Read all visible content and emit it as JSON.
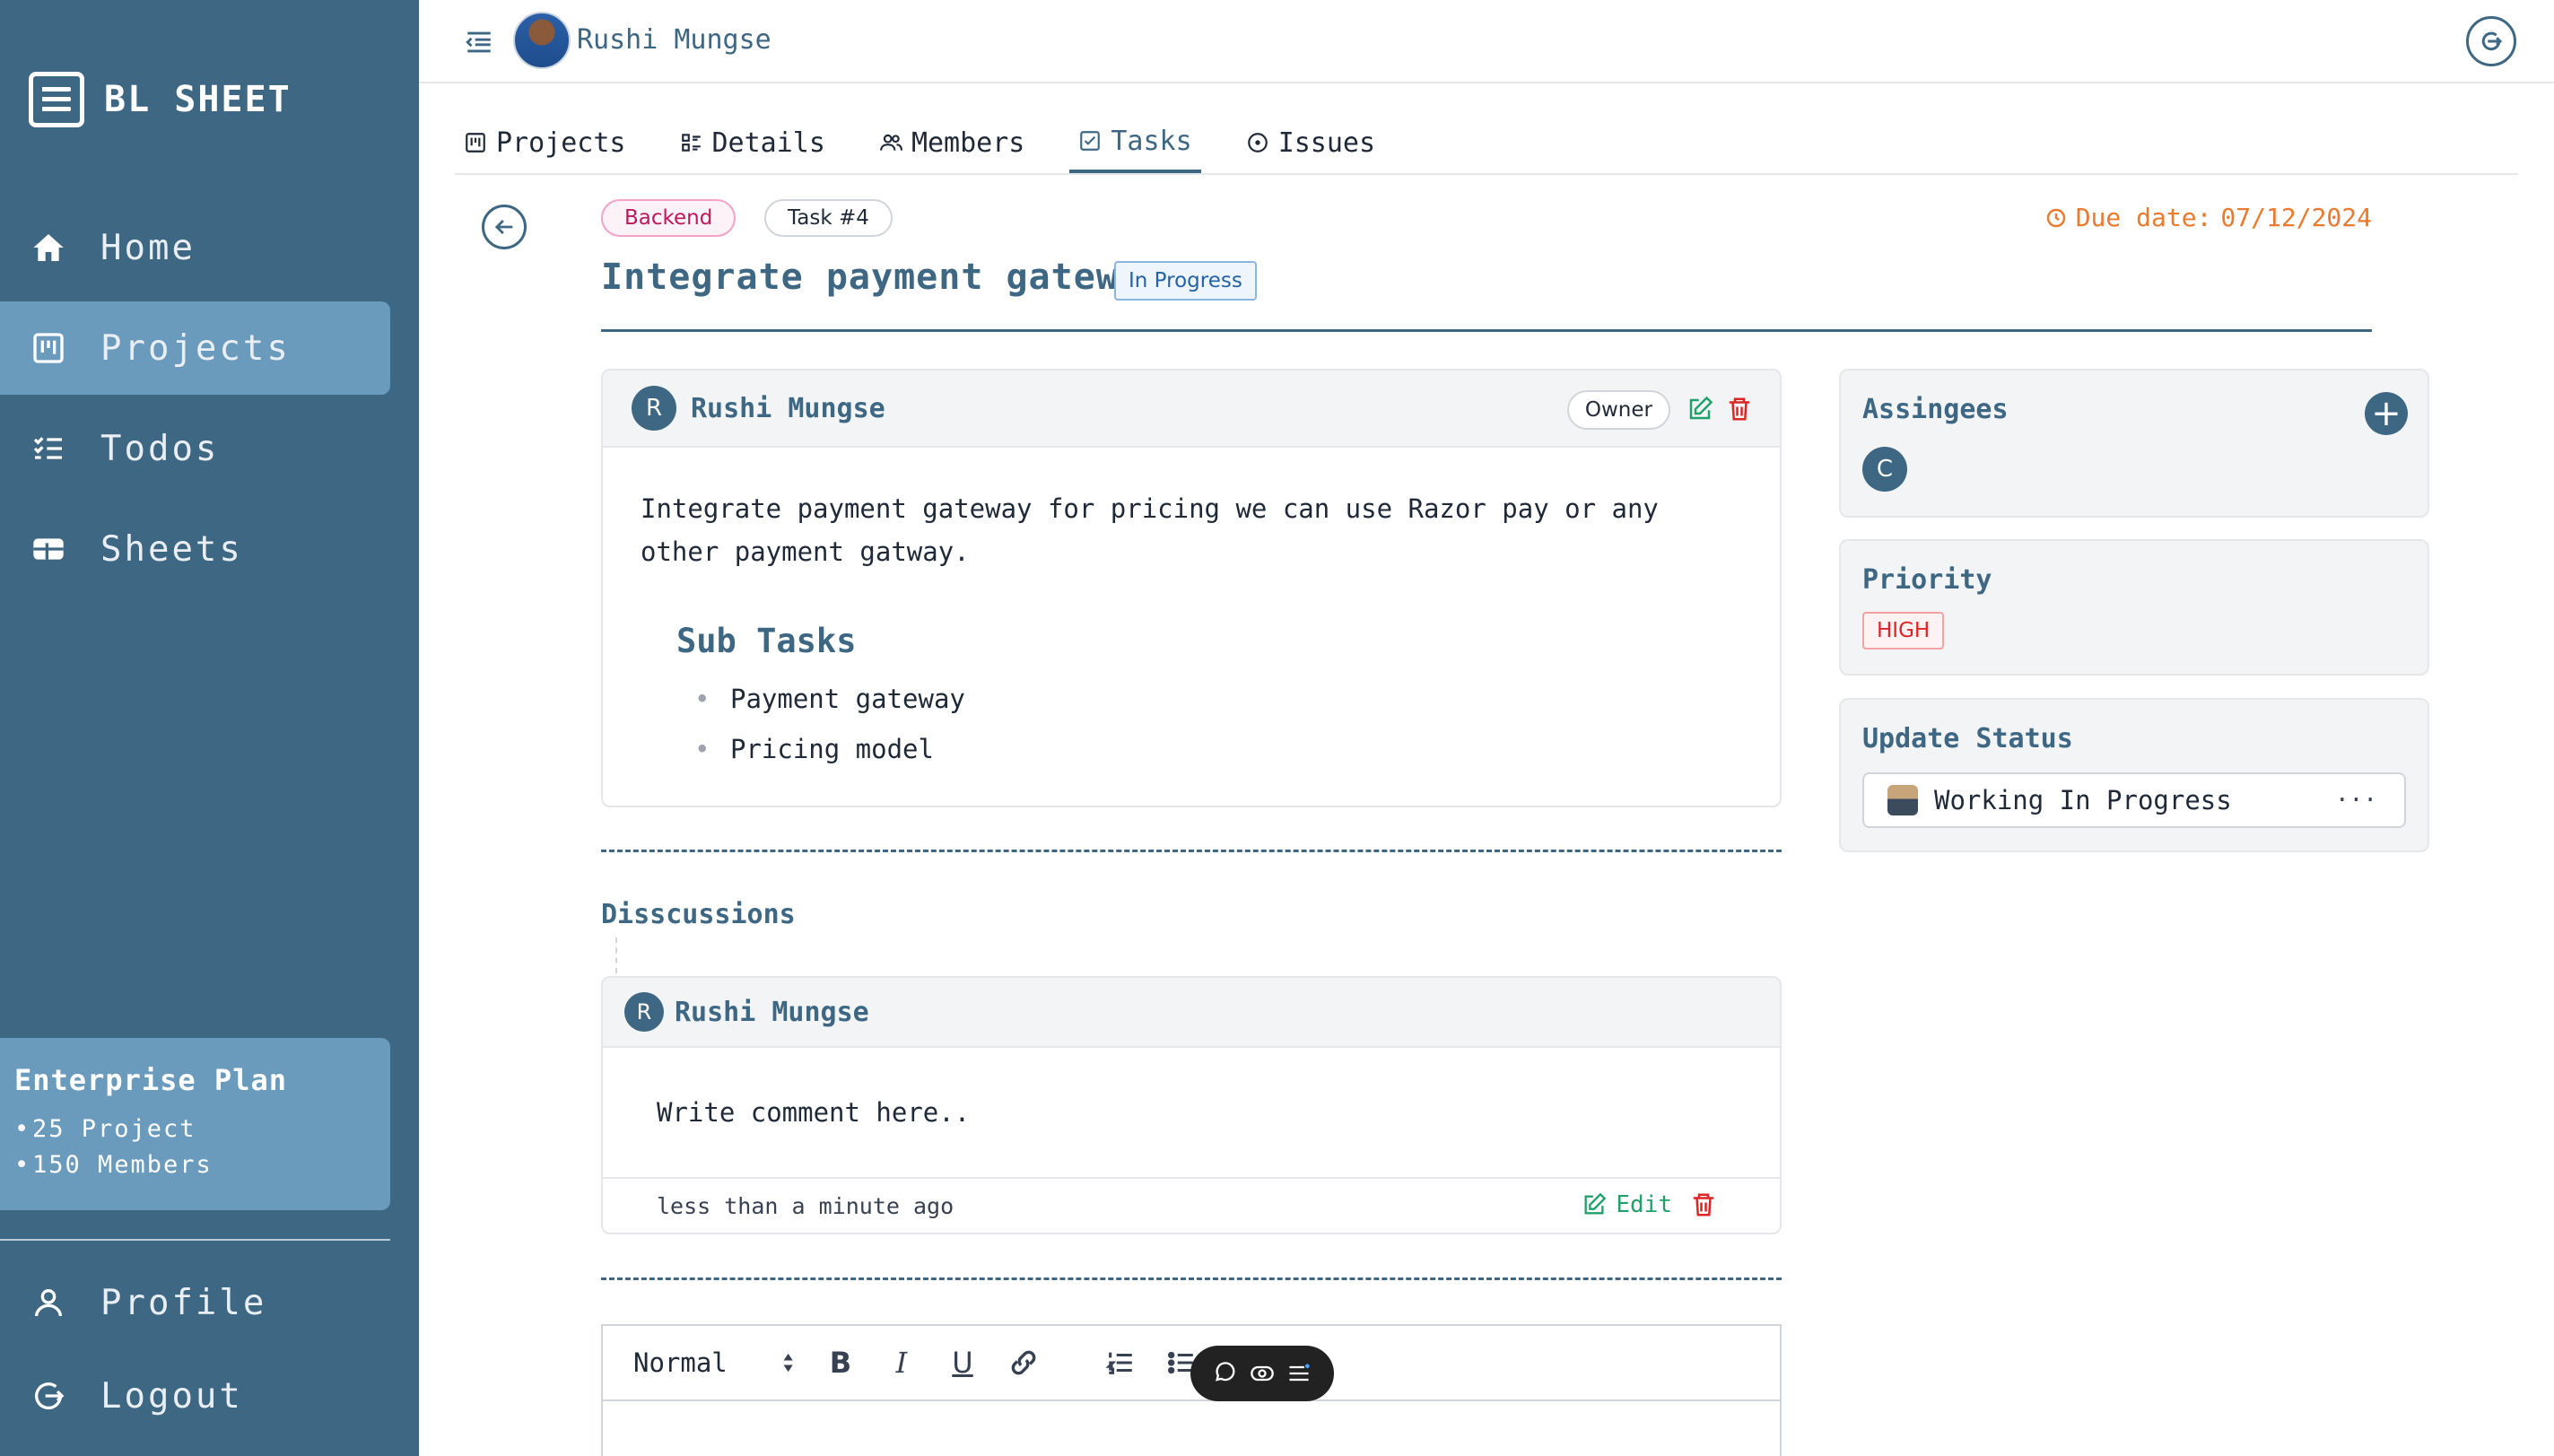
{
  "sidebar": {
    "brand": "BL SHEET",
    "items": [
      {
        "label": "Home",
        "icon": "home-icon"
      },
      {
        "label": "Projects",
        "icon": "board-icon",
        "active": true
      },
      {
        "label": "Todos",
        "icon": "checklist-icon"
      },
      {
        "label": "Sheets",
        "icon": "sheet-icon"
      }
    ],
    "plan": {
      "title": "Enterprise Plan",
      "features": [
        "25 Project",
        "150 Members"
      ]
    },
    "bottom_items": [
      {
        "label": "Profile",
        "icon": "user-icon"
      },
      {
        "label": "Logout",
        "icon": "logout-icon"
      }
    ]
  },
  "topbar": {
    "user_name": "Rushi Mungse"
  },
  "tabs": [
    {
      "label": "Projects"
    },
    {
      "label": "Details"
    },
    {
      "label": "Members"
    },
    {
      "label": "Tasks",
      "active": true
    },
    {
      "label": "Issues"
    }
  ],
  "task": {
    "tag": "Backend",
    "number": "Task #4",
    "due_label": "Due date:",
    "due_date": "07/12/2024",
    "title": "Integrate payment gateway",
    "status": "In Progress",
    "owner_name": "Rushi Mungse",
    "owner_initial": "R",
    "owner_badge": "Owner",
    "description": "Integrate payment gateway for pricing we can use Razor pay or any other payment gatway.",
    "subtasks_title": "Sub Tasks",
    "subtasks": [
      "Payment gateway",
      "Pricing model"
    ]
  },
  "discussions": {
    "title": "Disscussions",
    "comments": [
      {
        "author": "Rushi Mungse",
        "initial": "R",
        "text": "Write comment here..",
        "time": "less than a minute ago",
        "edit_label": "Edit"
      }
    ]
  },
  "editor": {
    "format": "Normal"
  },
  "panels": {
    "assignees": {
      "title": "Assingees",
      "members": [
        "C"
      ],
      "add_label": "+"
    },
    "priority": {
      "title": "Priority",
      "value": "HIGH"
    },
    "update_status": {
      "title": "Update Status",
      "value": "Working In Progress",
      "more": "···"
    }
  },
  "colors": {
    "primary": "#3e6783",
    "active_nav": "#6a9bbd",
    "due": "#ea7a2e",
    "success": "#22a06b",
    "danger": "#dc2626"
  }
}
